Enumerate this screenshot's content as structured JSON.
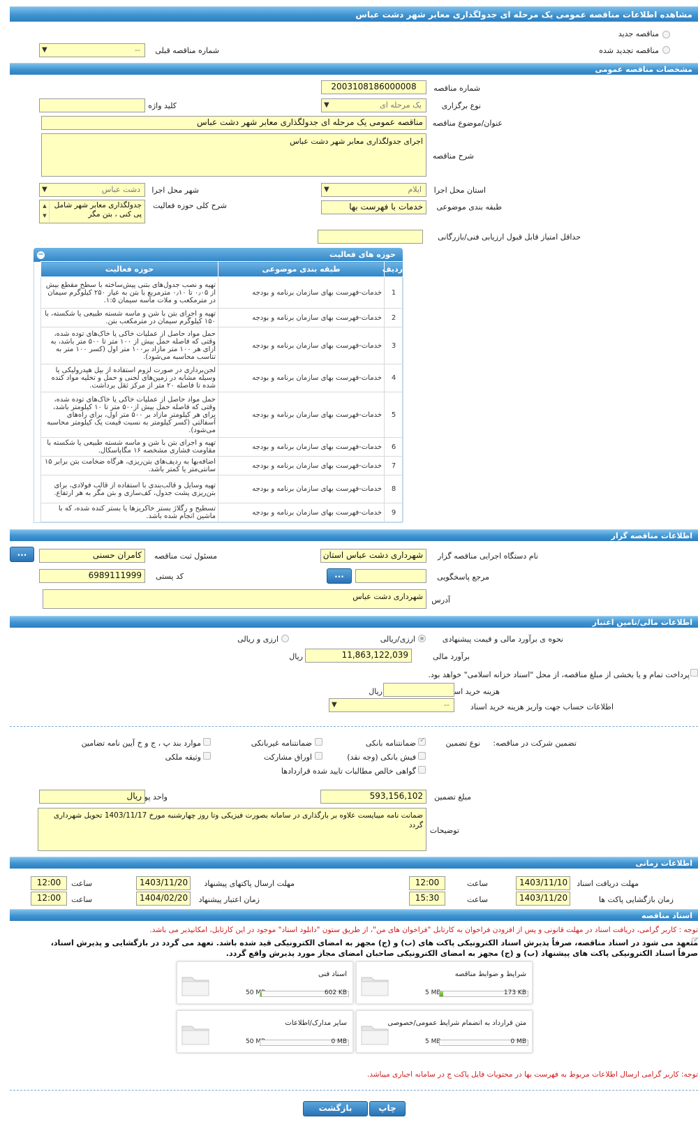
{
  "title": "مشاهده اطلاعات مناقصه عمومی یک مرحله ای جدولگذاری معابر شهر دشت عباس",
  "top": {
    "new_label": "مناقصه جدید",
    "renewed_label": "مناقصه تجدید شده",
    "prev_label": "شماره مناقصه قبلی",
    "prev_value": "--"
  },
  "general": {
    "header": "مشخصات مناقصه عمومی",
    "number_label": "شماره مناقصه",
    "number_value": "2003108186000008",
    "type_label": "نوع برگزاری",
    "type_value": "یک مرحله ای",
    "keyword_label": "کلید واژه",
    "keyword_value": "",
    "subject_label": "عنوان/موضوع مناقصه",
    "subject_value": "مناقصه عمومی یک مرحله ای جدولگذاری معابر شهر دشت عباس",
    "desc_label": "شرح مناقصه",
    "desc_value": "اجرای جدولگذاری معابر شهر دشت عباس",
    "province_label": "استان محل اجرا",
    "province_value": "ایلام",
    "city_label": "شهر محل اجرا",
    "city_value": "دشت عباس",
    "category_label": "طبقه بندی موضوعی",
    "category_value": "خدمات با فهرست بها",
    "scope_label": "شرح کلی حوزه فعالیت",
    "scope_value": "جدولگذاری معابر شهر شامل پی کنی ، بتن مگر",
    "min_score_label": "حداقل امتیاز قابل قبول ارزیابی فنی/بازرگانی",
    "min_score_value": ""
  },
  "activities": {
    "header": "حوزه های فعالیت",
    "col_row": "ردیف",
    "col_category": "طبقه بندی موضوعی",
    "col_scope": "حوزه فعالیت",
    "rows": [
      {
        "n": "1",
        "cat": "خدمات-فهرست بهای سازمان برنامه و بودجه",
        "scope": "تهیه و نصب جدول‌های بتنی پیش‌ساخته با سطح مقطع بیش از ۰٫۰۵ تا ۰٫۱۰ مترمربع با بتن به عیار ۲۵۰ کیلوگرم سیمان در مترمکعب و ملات ماسه سیمان ۱:۵."
      },
      {
        "n": "2",
        "cat": "خدمات-فهرست بهای سازمان برنامه و بودجه",
        "scope": "تهیه و اجرای بتن با شن و ماسه شسته طبیعی یا شکسته، با ۱۵۰ کیلوگرم سیمان در مترمکعب بتن."
      },
      {
        "n": "3",
        "cat": "خدمات-فهرست بهای سازمان برنامه و بودجه",
        "scope": "حمل مواد حاصل از عملیات خاکی یا خاک‌های توده شده، وقتی که فاصله حمل بیش از ۱۰۰ متر تا ۵۰۰ متر باشد، به ازای هر ۱۰۰ متر مازاد بر۱۰۰ متر اول (کسر ۱۰۰ متر به تناسب محاسبه می‌شود)."
      },
      {
        "n": "4",
        "cat": "خدمات-فهرست بهای سازمان برنامه و بودجه",
        "scope": "لجن‌برداری در صورت لزوم استفاده از بیل هیدرولیکی یا وسیله مشابه در زمین‌های لجنی و حمل و تخلیه مواد کنده شده تا فاصله ۲۰ متر از مرکز ثقل برداشت."
      },
      {
        "n": "5",
        "cat": "خدمات-فهرست بهای سازمان برنامه و بودجه",
        "scope": "حمل مواد حاصل از عملیات خاکی یا خاک‌های توده شده، وقتی که فاصله حمل بیش از۵۰۰ متر تا ۱۰ کیلومتر باشد، برای هر کیلومتر مازاد بر ۵۰۰ متر اول، برای راه‌های آسفالتی (کسر کیلومتر به نسبت قیمت یک کیلومتر محاسبه می‌شود)."
      },
      {
        "n": "6",
        "cat": "خدمات-فهرست بهای سازمان برنامه و بودجه",
        "scope": "تهیه و اجرای بتن با شن و ماسه شسته طبیعی یا شکسته با مقاومت فشاری مشخصه ۱۶ مگاپاسکال."
      },
      {
        "n": "7",
        "cat": "خدمات-فهرست بهای سازمان برنامه و بودجه",
        "scope": "اضافه‌بها به ردیف‌های بتن‌ریزی، هرگاه ضخامت بتن برابر ۱۵ سانتی‌متر یا کمتر باشد."
      },
      {
        "n": "8",
        "cat": "خدمات-فهرست بهای سازمان برنامه و بودجه",
        "scope": "تهیه وسایل و قالب‌بندی با استفاده از قالب فولادی، برای بتن‌ریزی پشت جدول، کف‌سازی و بتن مگر به هر ارتفاع."
      },
      {
        "n": "9",
        "cat": "خدمات-فهرست بهای سازمان برنامه و بودجه",
        "scope": "تسطیح و رگلاژ بستر خاکریزها یا بستر کنده شده، که با ماشین انجام شده باشد."
      }
    ]
  },
  "organizer": {
    "header": "اطلاعات مناقصه گزار",
    "org_label": "نام دستگاه اجرایی مناقصه گزار",
    "org_value": "شهرداری دشت عباس استان",
    "resp_label": "مسئول ثبت مناقصه",
    "resp_value": "کامران حسنی",
    "ref_label": "مرجع پاسخگویی",
    "ref_value": "",
    "postal_label": "کد پستی",
    "postal_value": "6989111999",
    "addr_label": "آدرس",
    "addr_value": "شهرداری دشت عباس",
    "dots": "..."
  },
  "finance": {
    "header": "اطلاعات مالی/تامین اعتبار",
    "estimate_method_label": "نحوه ی برآورد مالی و قیمت پیشنهادی",
    "opt1": "ارزی/ریالی",
    "opt2": "ارزی و ریالی",
    "estimate_label": "برآورد مالی",
    "estimate_value": "11,863,122,039",
    "rial": "ریال",
    "treasury_text": "پرداخت تمام و یا بخشی از مبلغ مناقصه، از محل \"اسناد خزانه اسلامی\" خواهد بود.",
    "doc_fee_label": "هزینه خرید اسناد",
    "doc_fee_value": "",
    "account_label": "اطلاعات حساب جهت واریز هزینه خرید اسناد",
    "account_value": "--"
  },
  "guarantee": {
    "title": "تضمین شرکت در مناقصه:",
    "type_label": "نوع تضمین",
    "opt_bank": "ضمانتنامه بانکی",
    "opt_nonbank": "ضمانتنامه غیربانکی",
    "opt_bcdh": "موارد بند پ ، ج و خ آیین نامه تضامین",
    "opt_check": "فیش بانکی (وجه نقد)",
    "opt_bonds": "اوراق مشارکت",
    "opt_property": "وثیقه ملکی",
    "opt_claims": "گواهی خالص مطالبات تایید شده قراردادها",
    "amount_label": "مبلغ تضمین",
    "amount_value": "593,156,102",
    "unit_label": "واحد پول",
    "unit_value": "ریال",
    "notes_label": "توضیحات",
    "notes_value": "ضمانت نامه میبایست علاوه بر بارگذاری در سامانه  بصورت فیزیکی وتا روز چهارشنبه مورخ 1403/11/17 تحویل شهرداری گردد"
  },
  "timing": {
    "header": "اطلاعات زمانی",
    "doc_recv_label": "مهلت دریافت اسناد",
    "doc_recv_date": "1403/11/10",
    "doc_recv_time": "12:00",
    "send_label": "مهلت ارسال پاکتهای پیشنهاد",
    "send_date": "1403/11/20",
    "send_time": "12:00",
    "open_label": "زمان بازگشایی پاکت ها",
    "open_date": "1403/11/20",
    "open_time": "15:30",
    "valid_label": "زمان اعتبار پیشنهاد",
    "valid_date": "1404/02/20",
    "valid_time": "12:00",
    "time_label": "ساعت"
  },
  "docs": {
    "header": "اسناد مناقصه",
    "note1": "توجه : کاربر گرامی، دریافت اسناد در مهلت قانونی و پس از افزودن فراخوان به کارتابل \"فراخوان های من\"، از طریق ستون \"دانلود اسناد\" موجود در این کارتابل، امکانپذیر می باشد.",
    "commit_line1": "متعهد می شود در اسناد مناقصه، صرفاً پذیرش اسناد الکترونیکی پاکت های (ب) و (ج) مجهز به امضای الکترونیکی قید شده باشد. تعهد می گردد در بازگشایی و پذیرش اسناد،",
    "commit_line2": "صرفاً اسناد الکترونیکی پاکت های پیشنهاد (ب) و (ج) مجهز به امضای الکترونیکی صاحبان امضای مجاز مورد پذیرش واقع گردد.",
    "files": [
      {
        "name": "شرایط و ضوابط مناقصه",
        "size": "173 KB",
        "max": "5 MB",
        "fill": 0.04
      },
      {
        "name": "اسناد فنی",
        "size": "602 KB",
        "max": "50 MB",
        "fill": 0.012
      },
      {
        "name": "متن قرارداد به انضمام شرایط عمومی/خصوصی",
        "size": "0 MB",
        "max": "5 MB",
        "fill": 0
      },
      {
        "name": "سایر مدارک/اطلاعات",
        "size": "0 MB",
        "max": "50 MB",
        "fill": 0
      }
    ],
    "note2": "توجه: کاربر گرامی ارسال اطلاعات مربوط به فهرست بها در محتویات فایل پاکت ج در سامانه اجباری میباشد."
  },
  "actions": {
    "print": "چاپ",
    "back": "بازگشت"
  },
  "colors": {
    "header_bar": "#3f93d0",
    "input_bg": "#ffffc0",
    "button": "#2a72b5",
    "note_red": "#d31a1a"
  }
}
